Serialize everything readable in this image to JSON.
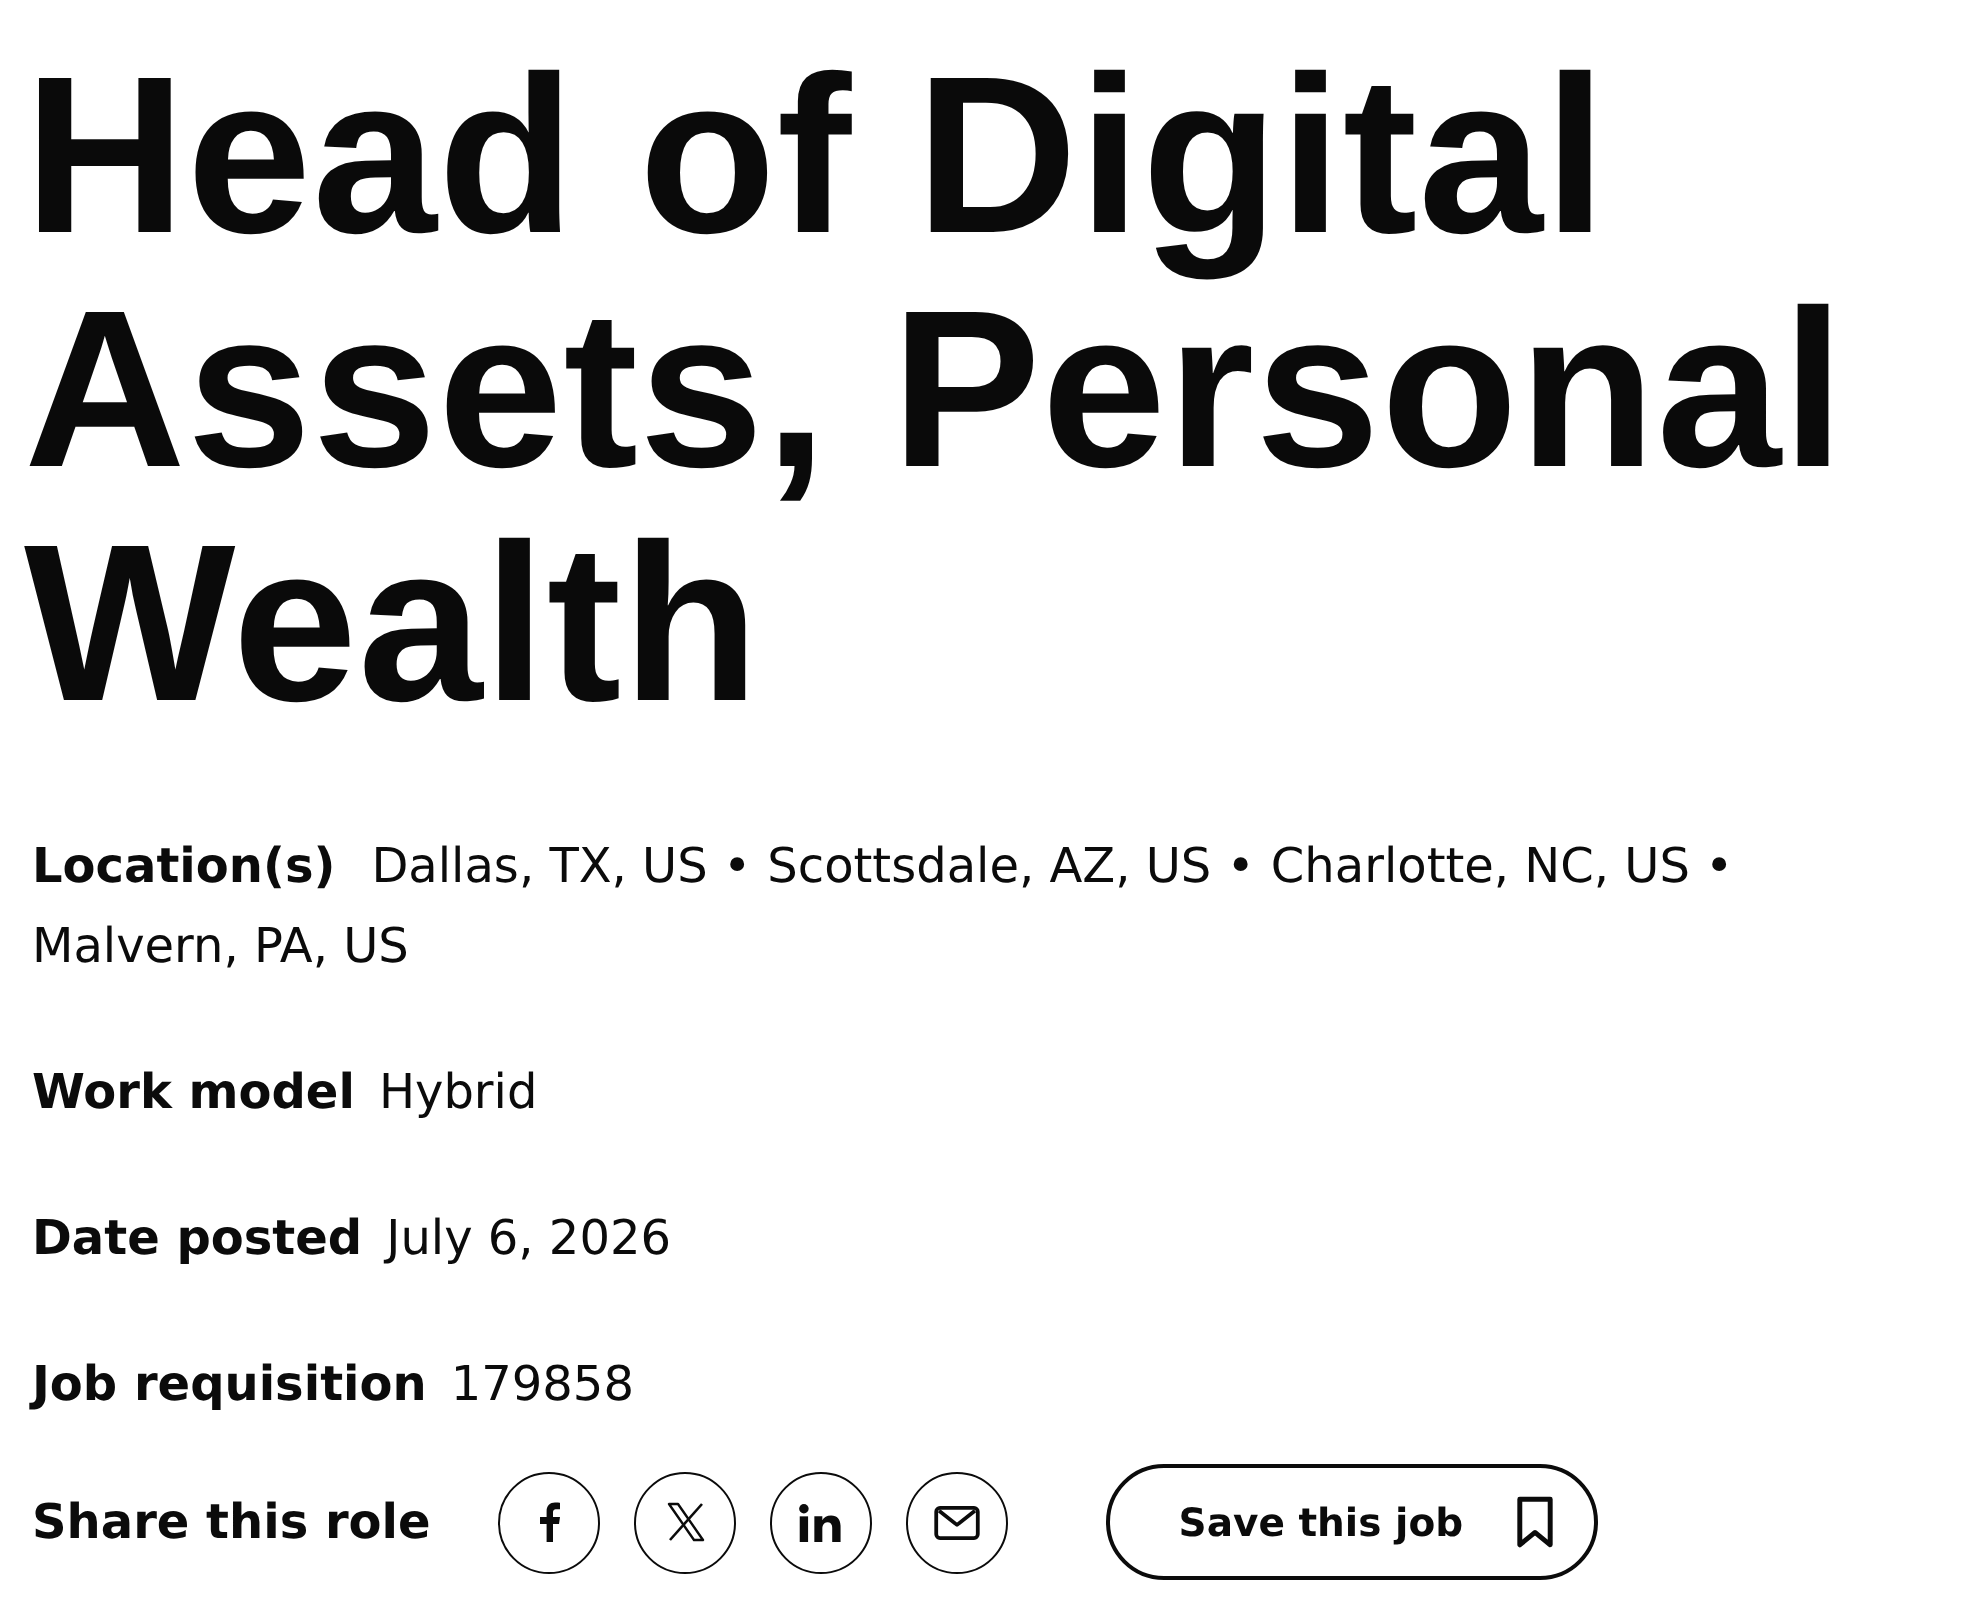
{
  "title": "Head of Digital Assets, Personal Wealth",
  "details": [
    {
      "kind": "locations",
      "label": "Location(s)",
      "values": [
        "Dallas, TX, US •",
        "Scottsdale, AZ, US •",
        "Charlotte, NC, US •",
        "Malvern, PA, US"
      ]
    },
    {
      "kind": "text",
      "label": "Work model",
      "value": "Hybrid"
    },
    {
      "kind": "text",
      "label": "Date posted",
      "value": "July 6, 2026"
    },
    {
      "kind": "text",
      "label": "Job requisition",
      "value": "179858"
    }
  ],
  "share": {
    "label": "Share this role",
    "channels": [
      {
        "kind": "facebook"
      },
      {
        "kind": "x"
      },
      {
        "kind": "linkedin"
      },
      {
        "kind": "email"
      }
    ]
  },
  "save_button": {
    "label": "Save this job"
  }
}
